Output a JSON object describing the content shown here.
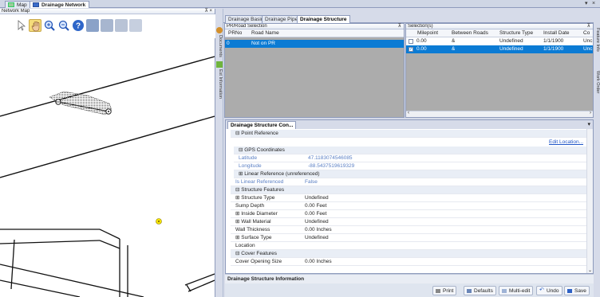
{
  "doc_tabs": [
    {
      "label": "Map"
    },
    {
      "label": "Drainage Network"
    }
  ],
  "window_controls": {
    "dropdown": "▾",
    "close": "×"
  },
  "map_pane": {
    "title": "Network Map",
    "pin": "⊼ ×"
  },
  "tools": [
    "select-arrow-icon",
    "pan-hand-icon",
    "zoom-in-icon",
    "zoom-out-icon",
    "help-icon",
    "layer-icon-1",
    "layer-icon-2",
    "layer-icon-3",
    "layer-icon-4"
  ],
  "side_tabs": [
    "Documents",
    "Ext Information"
  ],
  "right_side_tabs": [
    "Feature Info",
    "Work Order"
  ],
  "inner_tabs": [
    {
      "label": "Drainage Basin"
    },
    {
      "label": "Drainage Pipe"
    },
    {
      "label": "Drainage Structure"
    }
  ],
  "pr_road": {
    "title": "PR/Road Selection",
    "columns": [
      "PRNo",
      "Road Name"
    ],
    "rows": [
      {
        "prno": "0",
        "road": "Not on PR"
      }
    ]
  },
  "selection": {
    "title": "Selection(s)",
    "columns": [
      "Milepoint",
      "Between Roads",
      "Structure Type",
      "Install Date",
      "Co"
    ],
    "rows": [
      {
        "milepoint": "0.00",
        "between": "&",
        "type": "Undefined",
        "date": "1/1/1900",
        "co": "Unc"
      },
      {
        "milepoint": "0.00",
        "between": "&",
        "type": "Undefined",
        "date": "1/1/1900",
        "co": "Unc"
      }
    ]
  },
  "props": {
    "tab": "Drainage Structure Con...",
    "edit_link": "Edit Location...",
    "rows": [
      {
        "k": "⊟ Point Reference",
        "v": "",
        "kind": "section"
      },
      {
        "k": "⊟ GPS Coordinates",
        "v": "",
        "kind": "sub"
      },
      {
        "k": "Latitude",
        "v": "47.1183074546085",
        "kind": "dim"
      },
      {
        "k": "Longitude",
        "v": "-88.5437519619329",
        "kind": "dim"
      },
      {
        "k": "⊞ Linear Reference (unreferenced)",
        "v": "",
        "kind": "sub"
      },
      {
        "k": "Is Linear Referenced",
        "v": "False",
        "kind": "dim"
      },
      {
        "k": "⊟ Structure Features",
        "v": "",
        "kind": "section"
      },
      {
        "k": "⊞ Structure Type",
        "v": "Undefined",
        "kind": "row"
      },
      {
        "k": "Sump Depth",
        "v": "0.00 Feet",
        "kind": "row"
      },
      {
        "k": "⊞ Inside Diameter",
        "v": "0.00 Feet",
        "kind": "row"
      },
      {
        "k": "⊞ Wall Material",
        "v": "Undefined",
        "kind": "row"
      },
      {
        "k": "Wall Thickness",
        "v": "0.00 Inches",
        "kind": "row"
      },
      {
        "k": "⊞ Surface Type",
        "v": "Undefined",
        "kind": "row"
      },
      {
        "k": "Location",
        "v": "",
        "kind": "row"
      },
      {
        "k": "⊟ Cover Features",
        "v": "",
        "kind": "section"
      },
      {
        "k": "Cover Opening Size",
        "v": "0.00 Inches",
        "kind": "row"
      }
    ]
  },
  "info_title": "Drainage Structure Information",
  "buttons": [
    {
      "label": "Print"
    },
    {
      "label": "Defaults"
    },
    {
      "label": "Multi-edit"
    },
    {
      "label": "Undo"
    },
    {
      "label": "Save"
    }
  ],
  "colors": {
    "selection": "#0b7bd4",
    "frame": "#d6dbe9"
  }
}
